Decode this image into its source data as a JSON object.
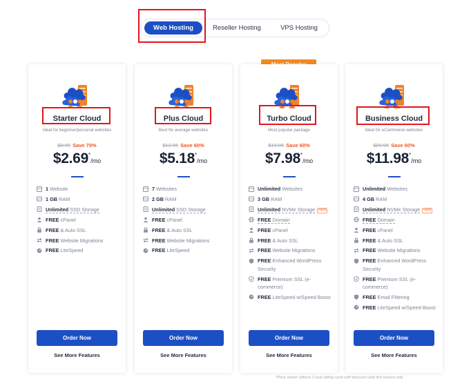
{
  "tabs": [
    {
      "label": "Web Hosting",
      "active": true
    },
    {
      "label": "Reseller Hosting",
      "active": false
    },
    {
      "label": "VPS Hosting",
      "active": false
    }
  ],
  "badge": "Most Popular",
  "plans": [
    {
      "name": "Starter Cloud",
      "subtitle": "Ideal for beginner/personal websites",
      "old_price": "$8.95",
      "save": "Save 70%",
      "price": "$2.69",
      "asterisk": "*",
      "per": "/mo",
      "features": [
        {
          "icon": "globe-icon",
          "bold": "1",
          "text": " Website"
        },
        {
          "icon": "server-icon",
          "bold": "1 GB",
          "text": " RAM"
        },
        {
          "icon": "storage-icon",
          "bold": "Unlimited",
          "text": " SSD Storage",
          "dashed": true
        },
        {
          "icon": "user-icon",
          "bold": "FREE",
          "text": " cPanel"
        },
        {
          "icon": "lock-icon",
          "bold": "FREE",
          "text": " & Auto SSL"
        },
        {
          "icon": "migrate-icon",
          "bold": "FREE",
          "text": " Website Migrations"
        },
        {
          "icon": "speed-icon",
          "bold": "FREE",
          "text": " LiteSpeed"
        }
      ],
      "order_label": "Order Now",
      "more_label": "See More Features"
    },
    {
      "name": "Plus Cloud",
      "subtitle": "Best for average websites",
      "old_price": "$12.95",
      "save": "Save 60%",
      "price": "$5.18",
      "asterisk": "*",
      "per": "/mo",
      "features": [
        {
          "icon": "globe-icon",
          "bold": "7",
          "text": " Websites"
        },
        {
          "icon": "server-icon",
          "bold": "2 GB",
          "text": " RAM"
        },
        {
          "icon": "storage-icon",
          "bold": "Unlimited",
          "text": " SSD Storage",
          "dashed": true
        },
        {
          "icon": "user-icon",
          "bold": "FREE",
          "text": " cPanel"
        },
        {
          "icon": "lock-icon",
          "bold": "FREE",
          "text": " & Auto SSL"
        },
        {
          "icon": "migrate-icon",
          "bold": "FREE",
          "text": " Website Migrations"
        },
        {
          "icon": "speed-icon",
          "bold": "FREE",
          "text": " LiteSpeed"
        }
      ],
      "order_label": "Order Now",
      "more_label": "See More Features"
    },
    {
      "name": "Turbo Cloud",
      "subtitle": "Most popular package",
      "old_price": "$19.95",
      "save": "Save 60%",
      "price": "$7.98",
      "asterisk": "*",
      "per": "/mo",
      "features": [
        {
          "icon": "globe-icon",
          "bold": "Unlimited",
          "text": " Websites"
        },
        {
          "icon": "server-icon",
          "bold": "3 GB",
          "text": " RAM"
        },
        {
          "icon": "storage-icon",
          "bold": "Unlimited",
          "text": " NVMe Storage",
          "dashed": true,
          "tag": "NEW"
        },
        {
          "icon": "domain-icon",
          "bold": "FREE",
          "text": " Domain",
          "dashed": true
        },
        {
          "icon": "user-icon",
          "bold": "FREE",
          "text": " cPanel"
        },
        {
          "icon": "lock-icon",
          "bold": "FREE",
          "text": " & Auto SSL"
        },
        {
          "icon": "migrate-icon",
          "bold": "FREE",
          "text": " Website Migrations"
        },
        {
          "icon": "shield-icon",
          "bold": "FREE",
          "text": " Enhanced WordPress Security"
        },
        {
          "icon": "ssl-icon",
          "bold": "FREE",
          "text": " Premium SSL (e-commerce)"
        },
        {
          "icon": "speed-icon",
          "bold": "FREE",
          "text": " LiteSpeed w/Speed Boost"
        }
      ],
      "order_label": "Order Now",
      "more_label": "See More Features"
    },
    {
      "name": "Business Cloud",
      "subtitle": "Ideal for eCommerce websites",
      "old_price": "$29.95",
      "save": "Save 60%",
      "price": "$11.98",
      "asterisk": "*",
      "per": "/mo",
      "features": [
        {
          "icon": "globe-icon",
          "bold": "Unlimited",
          "text": " Websites"
        },
        {
          "icon": "server-icon",
          "bold": "4 GB",
          "text": " RAM"
        },
        {
          "icon": "storage-icon",
          "bold": "Unlimited",
          "text": " NVMe Storage",
          "dashed": true,
          "tag": "NEW"
        },
        {
          "icon": "domain-icon",
          "bold": "FREE",
          "text": " Domain",
          "dashed": true
        },
        {
          "icon": "user-icon",
          "bold": "FREE",
          "text": " cPanel"
        },
        {
          "icon": "lock-icon",
          "bold": "FREE",
          "text": " & Auto SSL"
        },
        {
          "icon": "migrate-icon",
          "bold": "FREE",
          "text": " Website Migrations"
        },
        {
          "icon": "shield-icon",
          "bold": "FREE",
          "text": " Enhanced WordPress Security"
        },
        {
          "icon": "ssl-icon",
          "bold": "FREE",
          "text": " Premium SSL (e-commerce)"
        },
        {
          "icon": "filter-icon",
          "bold": "FREE",
          "text": " Email Filtering"
        },
        {
          "icon": "speed-icon",
          "bold": "FREE",
          "text": " LiteSpeed w/Speed Boost"
        }
      ],
      "order_label": "Order Now",
      "more_label": "See More Features"
    }
  ],
  "footnote": "*Price shown reflects 3 year billing cycle with discount valid first invoice only.",
  "colors": {
    "primary": "#1d4fc4",
    "accent_orange": "#f58a1f",
    "save_red": "#f0561f",
    "annotation_red": "#e4121c"
  }
}
